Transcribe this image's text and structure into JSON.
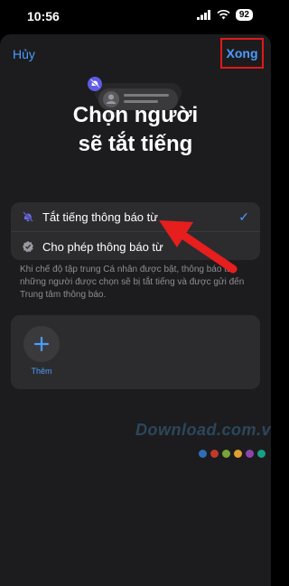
{
  "status_bar": {
    "time": "10:56",
    "battery": "92"
  },
  "nav": {
    "cancel_label": "Hủy",
    "done_label": "Xong"
  },
  "header": {
    "title_line1": "Chọn người",
    "title_line2": "sẽ tắt tiếng"
  },
  "options": [
    {
      "label": "Tắt tiếng thông báo từ",
      "icon": "bell-slash-icon",
      "selected": true
    },
    {
      "label": "Cho phép thông báo từ",
      "icon": "checkmark-seal-icon",
      "selected": false
    }
  ],
  "footnote": "Khi chế độ tập trung Cá nhân được bật, thông báo từ những người được chọn sẽ bị tắt tiếng và được gửi đến Trung tâm thông báo.",
  "people": {
    "add_label": "Thêm"
  },
  "watermark": "Download.com.vn",
  "colors": {
    "accent": "#4b9cff",
    "highlight_box": "#e01919",
    "arrow": "#e61e1e",
    "sheet_bg": "#1c1c1e",
    "card_bg": "#2c2c2e",
    "watermark_dots": [
      "#2f6fb5",
      "#c0392b",
      "#7aa33a",
      "#e0a030",
      "#8e44ad",
      "#16a085"
    ]
  }
}
